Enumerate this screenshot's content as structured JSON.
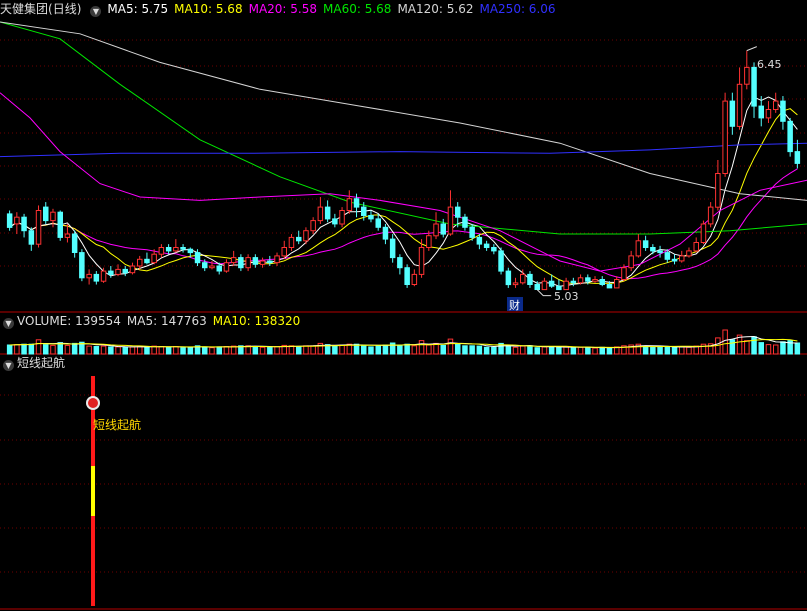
{
  "colors": {
    "up": "#ff3232",
    "down": "#54ffff",
    "grid": "#6e0000",
    "panel_border": "#b30000",
    "ma5": "#ffffff",
    "ma10": "#ffff00",
    "ma20": "#ff00ff",
    "ma60": "#00e600",
    "ma120": "#d4d4d4",
    "ma250": "#3030ff",
    "text": "#dcdcdc",
    "signal_label": "#ffd700"
  },
  "main": {
    "stock": "天健集团",
    "period": "(日线)",
    "legend": [
      {
        "key": "ma5",
        "label": "MA5: 5.75"
      },
      {
        "key": "ma10",
        "label": "MA10: 5.68"
      },
      {
        "key": "ma20",
        "label": "MA20: 5.58"
      },
      {
        "key": "ma60",
        "label": "MA60: 5.68"
      },
      {
        "key": "ma120",
        "label": "MA120: 5.62"
      },
      {
        "key": "ma250",
        "label": "MA250: 6.06"
      }
    ],
    "high_mark": "6.45",
    "low_mark": "5.03",
    "badge": "财"
  },
  "volume": {
    "title": "VOLUME: 139554",
    "ma5": "MA5: 147763",
    "ma10": "MA10: 138320"
  },
  "indicator": {
    "title": "短线起航",
    "signal_label": "短线起航"
  },
  "chart_data": {
    "type": "candlestick",
    "y_range": [
      4.98,
      6.62
    ],
    "candles": [
      [
        5.48,
        5.4,
        5.5,
        5.38
      ],
      [
        5.42,
        5.46,
        5.49,
        5.36
      ],
      [
        5.46,
        5.38,
        5.48,
        5.34
      ],
      [
        5.38,
        5.3,
        5.4,
        5.26
      ],
      [
        5.3,
        5.5,
        5.53,
        5.28
      ],
      [
        5.52,
        5.44,
        5.55,
        5.42
      ],
      [
        5.44,
        5.49,
        5.51,
        5.4
      ],
      [
        5.49,
        5.34,
        5.5,
        5.32
      ],
      [
        5.34,
        5.36,
        5.42,
        5.31
      ],
      [
        5.36,
        5.25,
        5.38,
        5.22
      ],
      [
        5.25,
        5.1,
        5.27,
        5.08
      ],
      [
        5.1,
        5.12,
        5.15,
        5.06
      ],
      [
        5.12,
        5.08,
        5.14,
        5.06
      ],
      [
        5.08,
        5.14,
        5.16,
        5.07
      ],
      [
        5.14,
        5.12,
        5.17,
        5.1
      ],
      [
        5.12,
        5.15,
        5.18,
        5.11
      ],
      [
        5.15,
        5.13,
        5.17,
        5.11
      ],
      [
        5.13,
        5.17,
        5.19,
        5.12
      ],
      [
        5.17,
        5.21,
        5.23,
        5.15
      ],
      [
        5.21,
        5.19,
        5.25,
        5.18
      ],
      [
        5.19,
        5.24,
        5.27,
        5.18
      ],
      [
        5.24,
        5.28,
        5.3,
        5.22
      ],
      [
        5.28,
        5.26,
        5.3,
        5.24
      ],
      [
        5.26,
        5.28,
        5.33,
        5.25
      ],
      [
        5.28,
        5.27,
        5.3,
        5.25
      ],
      [
        5.27,
        5.25,
        5.28,
        5.22
      ],
      [
        5.25,
        5.19,
        5.27,
        5.17
      ],
      [
        5.19,
        5.16,
        5.21,
        5.14
      ],
      [
        5.16,
        5.17,
        5.2,
        5.15
      ],
      [
        5.17,
        5.14,
        5.19,
        5.12
      ],
      [
        5.14,
        5.19,
        5.21,
        5.13
      ],
      [
        5.19,
        5.22,
        5.26,
        5.17
      ],
      [
        5.22,
        5.16,
        5.24,
        5.14
      ],
      [
        5.16,
        5.22,
        5.24,
        5.14
      ],
      [
        5.22,
        5.18,
        5.24,
        5.16
      ],
      [
        5.18,
        5.2,
        5.22,
        5.16
      ],
      [
        5.2,
        5.19,
        5.23,
        5.17
      ],
      [
        5.19,
        5.23,
        5.25,
        5.17
      ],
      [
        5.23,
        5.28,
        5.32,
        5.21
      ],
      [
        5.28,
        5.34,
        5.36,
        5.26
      ],
      [
        5.34,
        5.32,
        5.38,
        5.3
      ],
      [
        5.32,
        5.38,
        5.4,
        5.3
      ],
      [
        5.38,
        5.44,
        5.46,
        5.36
      ],
      [
        5.44,
        5.52,
        5.58,
        5.42
      ],
      [
        5.52,
        5.45,
        5.56,
        5.43
      ],
      [
        5.45,
        5.42,
        5.48,
        5.4
      ],
      [
        5.42,
        5.5,
        5.52,
        5.4
      ],
      [
        5.5,
        5.57,
        5.62,
        5.48
      ],
      [
        5.57,
        5.52,
        5.6,
        5.46
      ],
      [
        5.52,
        5.47,
        5.55,
        5.44
      ],
      [
        5.47,
        5.45,
        5.5,
        5.43
      ],
      [
        5.45,
        5.4,
        5.48,
        5.38
      ],
      [
        5.4,
        5.33,
        5.42,
        5.3
      ],
      [
        5.33,
        5.22,
        5.36,
        5.19
      ],
      [
        5.22,
        5.16,
        5.24,
        5.12
      ],
      [
        5.16,
        5.06,
        5.18,
        5.04
      ],
      [
        5.06,
        5.12,
        5.15,
        5.05
      ],
      [
        5.12,
        5.28,
        5.33,
        5.1
      ],
      [
        5.28,
        5.35,
        5.38,
        5.26
      ],
      [
        5.35,
        5.42,
        5.49,
        5.33
      ],
      [
        5.42,
        5.36,
        5.45,
        5.34
      ],
      [
        5.36,
        5.52,
        5.62,
        5.35
      ],
      [
        5.52,
        5.46,
        5.55,
        5.4
      ],
      [
        5.46,
        5.4,
        5.48,
        5.38
      ],
      [
        5.4,
        5.34,
        5.42,
        5.32
      ],
      [
        5.34,
        5.3,
        5.36,
        5.27
      ],
      [
        5.3,
        5.28,
        5.32,
        5.26
      ],
      [
        5.28,
        5.26,
        5.3,
        5.24
      ],
      [
        5.26,
        5.14,
        5.28,
        5.12
      ],
      [
        5.14,
        5.06,
        5.16,
        5.04
      ],
      [
        5.06,
        5.07,
        5.1,
        5.04
      ],
      [
        5.07,
        5.12,
        5.15,
        5.06
      ],
      [
        5.12,
        5.06,
        5.14,
        5.04
      ],
      [
        5.06,
        5.03,
        5.08,
        5.03
      ],
      [
        5.03,
        5.08,
        5.1,
        5.03
      ],
      [
        5.08,
        5.05,
        5.12,
        5.04
      ],
      [
        5.05,
        5.03,
        5.09,
        5.03
      ],
      [
        5.03,
        5.08,
        5.1,
        5.03
      ],
      [
        5.08,
        5.07,
        5.1,
        5.05
      ],
      [
        5.07,
        5.1,
        5.12,
        5.06
      ],
      [
        5.1,
        5.08,
        5.12,
        5.06
      ],
      [
        5.08,
        5.09,
        5.11,
        5.07
      ],
      [
        5.09,
        5.06,
        5.11,
        5.05
      ],
      [
        5.06,
        5.04,
        5.08,
        5.04
      ],
      [
        5.04,
        5.09,
        5.11,
        5.04
      ],
      [
        5.09,
        5.16,
        5.18,
        5.08
      ],
      [
        5.16,
        5.23,
        5.26,
        5.14
      ],
      [
        5.23,
        5.32,
        5.36,
        5.22
      ],
      [
        5.32,
        5.28,
        5.35,
        5.26
      ],
      [
        5.28,
        5.26,
        5.3,
        5.24
      ],
      [
        5.26,
        5.25,
        5.29,
        5.22
      ],
      [
        5.25,
        5.21,
        5.27,
        5.19
      ],
      [
        5.21,
        5.2,
        5.24,
        5.18
      ],
      [
        5.2,
        5.23,
        5.26,
        5.19
      ],
      [
        5.23,
        5.26,
        5.28,
        5.22
      ],
      [
        5.26,
        5.31,
        5.34,
        5.25
      ],
      [
        5.31,
        5.42,
        5.44,
        5.3
      ],
      [
        5.42,
        5.52,
        5.55,
        5.4
      ],
      [
        5.52,
        5.72,
        5.8,
        5.5
      ],
      [
        5.72,
        6.15,
        6.2,
        5.7
      ],
      [
        6.15,
        6.0,
        6.2,
        5.95
      ],
      [
        6.0,
        6.25,
        6.35,
        5.98
      ],
      [
        6.25,
        6.35,
        6.45,
        6.22
      ],
      [
        6.35,
        6.12,
        6.38,
        6.05
      ],
      [
        6.12,
        6.05,
        6.18,
        6.0
      ],
      [
        6.05,
        6.1,
        6.15,
        6.02
      ],
      [
        6.1,
        6.15,
        6.2,
        6.08
      ],
      [
        6.15,
        6.03,
        6.18,
        5.98
      ],
      [
        6.03,
        5.85,
        6.05,
        5.82
      ],
      [
        5.85,
        5.78,
        5.92,
        5.75
      ]
    ],
    "volume_ranges": [
      0,
      160000
    ]
  }
}
